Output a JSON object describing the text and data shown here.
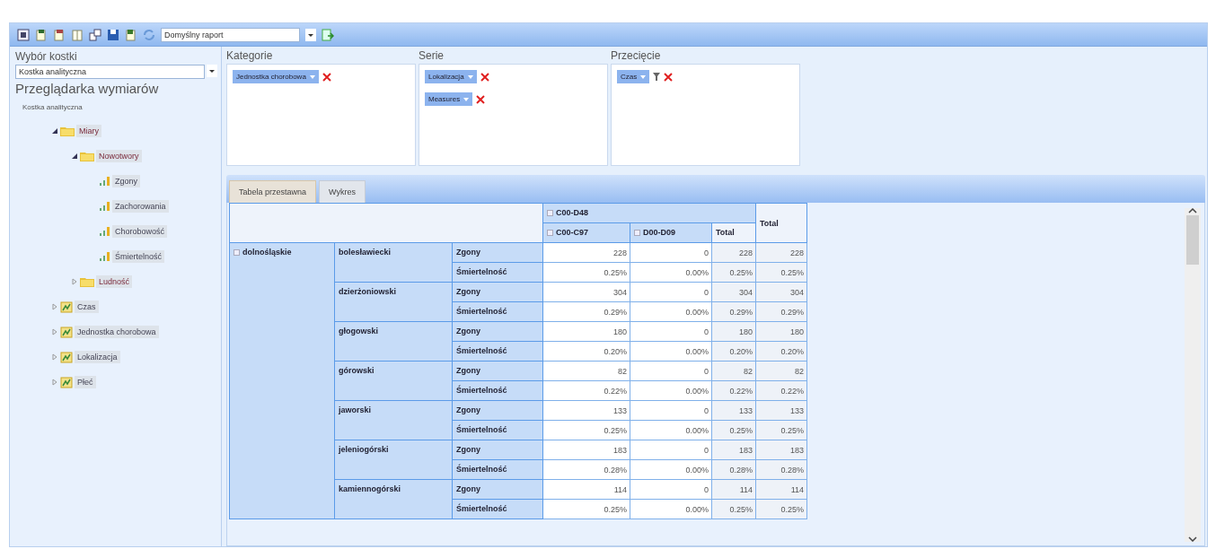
{
  "toolbar": {
    "report_select": {
      "value": "Domyślny raport"
    }
  },
  "cube_selector": {
    "label": "Wybór kostki",
    "value": "Kostka analityczna"
  },
  "dimension_browser": {
    "title": "Przeglądarka wymiarów",
    "root": "Kostka analityczna",
    "tree": [
      {
        "label": "Miary",
        "kind": "folder",
        "expanded": true,
        "children": [
          {
            "label": "Nowotwory",
            "kind": "folder",
            "expanded": true,
            "children": [
              {
                "label": "Zgony",
                "kind": "measure"
              },
              {
                "label": "Zachorowania",
                "kind": "measure"
              },
              {
                "label": "Chorobowość",
                "kind": "measure"
              },
              {
                "label": "Śmiertelność",
                "kind": "measure"
              }
            ]
          },
          {
            "label": "Ludność",
            "kind": "folder",
            "expanded": false
          }
        ]
      },
      {
        "label": "Czas",
        "kind": "dimension",
        "expanded": false
      },
      {
        "label": "Jednostka chorobowa",
        "kind": "dimension",
        "expanded": false
      },
      {
        "label": "Lokalizacja",
        "kind": "dimension",
        "expanded": false
      },
      {
        "label": "Płeć",
        "kind": "dimension",
        "expanded": false
      }
    ]
  },
  "zones": [
    {
      "title": "Kategorie",
      "chips": [
        {
          "label": "Jednostka chorobowa",
          "filtered": false
        }
      ]
    },
    {
      "title": "Serie",
      "chips": [
        {
          "label": "Lokalizacja",
          "filtered": false
        },
        {
          "label": "Measures",
          "filtered": false
        }
      ]
    },
    {
      "title": "Przecięcie",
      "chips": [
        {
          "label": "Czas",
          "filtered": true
        }
      ]
    }
  ],
  "tabs": [
    {
      "label": "Tabela przestawna",
      "selected": true
    },
    {
      "label": "Wykres",
      "selected": false
    }
  ],
  "pivot": {
    "column_group": {
      "label": "C00-D48",
      "columns": [
        "C00-C97",
        "D00-D09",
        "Total"
      ]
    },
    "grand_total": "Total",
    "region": {
      "label": "dolnośląskie"
    },
    "rows": [
      {
        "county": "bolesławiecki",
        "measures": [
          {
            "name": "Zgony",
            "values": [
              "228",
              "0",
              "228",
              "228"
            ]
          },
          {
            "name": "Śmiertelność",
            "values": [
              "0.25%",
              "0.00%",
              "0.25%",
              "0.25%"
            ]
          }
        ]
      },
      {
        "county": "dzierżoniowski",
        "measures": [
          {
            "name": "Zgony",
            "values": [
              "304",
              "0",
              "304",
              "304"
            ]
          },
          {
            "name": "Śmiertelność",
            "values": [
              "0.29%",
              "0.00%",
              "0.29%",
              "0.29%"
            ]
          }
        ]
      },
      {
        "county": "głogowski",
        "measures": [
          {
            "name": "Zgony",
            "values": [
              "180",
              "0",
              "180",
              "180"
            ]
          },
          {
            "name": "Śmiertelność",
            "values": [
              "0.20%",
              "0.00%",
              "0.20%",
              "0.20%"
            ]
          }
        ]
      },
      {
        "county": "górowski",
        "measures": [
          {
            "name": "Zgony",
            "values": [
              "82",
              "0",
              "82",
              "82"
            ]
          },
          {
            "name": "Śmiertelność",
            "values": [
              "0.22%",
              "0.00%",
              "0.22%",
              "0.22%"
            ]
          }
        ]
      },
      {
        "county": "jaworski",
        "measures": [
          {
            "name": "Zgony",
            "values": [
              "133",
              "0",
              "133",
              "133"
            ]
          },
          {
            "name": "Śmiertelność",
            "values": [
              "0.25%",
              "0.00%",
              "0.25%",
              "0.25%"
            ]
          }
        ]
      },
      {
        "county": "jeleniogórski",
        "measures": [
          {
            "name": "Zgony",
            "values": [
              "183",
              "0",
              "183",
              "183"
            ]
          },
          {
            "name": "Śmiertelność",
            "values": [
              "0.28%",
              "0.00%",
              "0.28%",
              "0.28%"
            ]
          }
        ]
      },
      {
        "county": "kamiennogórski",
        "measures": [
          {
            "name": "Zgony",
            "values": [
              "114",
              "0",
              "114",
              "114"
            ]
          },
          {
            "name": "Śmiertelność",
            "values": [
              "0.25%",
              "0.00%",
              "0.25%",
              "0.25%"
            ]
          }
        ]
      }
    ]
  }
}
